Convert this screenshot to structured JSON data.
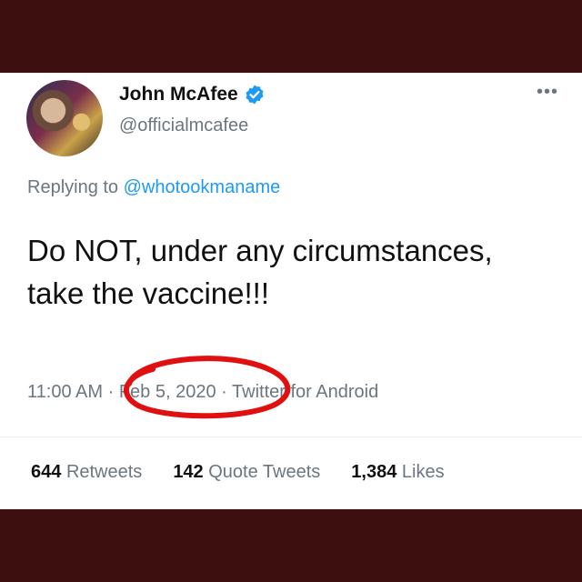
{
  "author": {
    "name": "John McAfee",
    "handle": "@officialmcafee"
  },
  "reply": {
    "prefix": "Replying to",
    "mention": "@whotookmaname"
  },
  "tweet_text": "Do NOT, under any circumstances, take the vaccine!!!",
  "meta": {
    "time": "11:00 AM",
    "date": "Feb 5, 2020",
    "source": "Twitter for Android",
    "separator": "·"
  },
  "stats": {
    "retweets_count": "644",
    "retweets_label": "Retweets",
    "quotes_count": "142",
    "quotes_label": "Quote Tweets",
    "likes_count": "1,384",
    "likes_label": "Likes"
  },
  "colors": {
    "frame": "#3d0f0f",
    "verified": "#1d9bf0",
    "annotation": "#e01010"
  },
  "icons": {
    "verified": "verified-badge-icon",
    "more": "more-options-icon"
  }
}
